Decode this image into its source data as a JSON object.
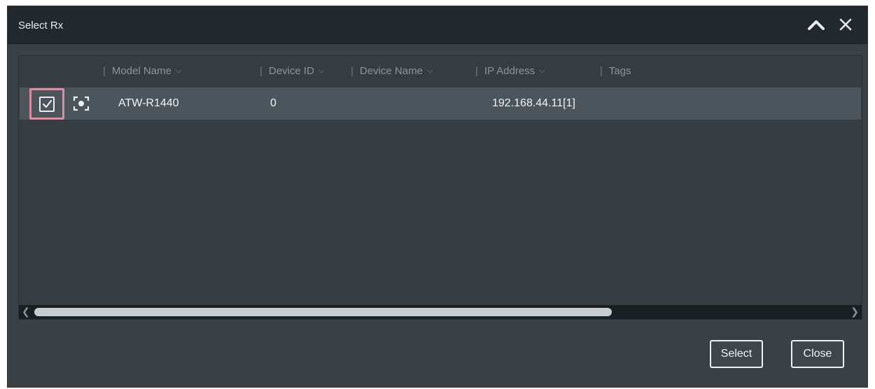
{
  "dialog": {
    "title": "Select Rx",
    "collapse_icon": "chevron-up-icon",
    "close_icon": "close-icon"
  },
  "grid": {
    "columns": [
      {
        "label": "Model Name",
        "sortable": true
      },
      {
        "label": "Device ID",
        "sortable": true
      },
      {
        "label": "Device Name",
        "sortable": true
      },
      {
        "label": "IP Address",
        "sortable": true
      },
      {
        "label": "Tags",
        "sortable": false
      }
    ],
    "rows": [
      {
        "checked": true,
        "locate_icon": "locate-icon",
        "model_name": "ATW-R1440",
        "device_id": "0",
        "device_name": "",
        "ip_address": "192.168.44.11[1]",
        "tags": ""
      }
    ],
    "scroll_left_icon": "scroll-left-arrow-icon",
    "scroll_right_icon": "scroll-right-arrow-icon"
  },
  "footer": {
    "select_label": "Select",
    "close_label": "Close"
  },
  "colors": {
    "titlebar": "#22282d",
    "panel": "#3a4146",
    "row_selected": "#4c555b",
    "highlight_frame": "#d98fa2"
  }
}
